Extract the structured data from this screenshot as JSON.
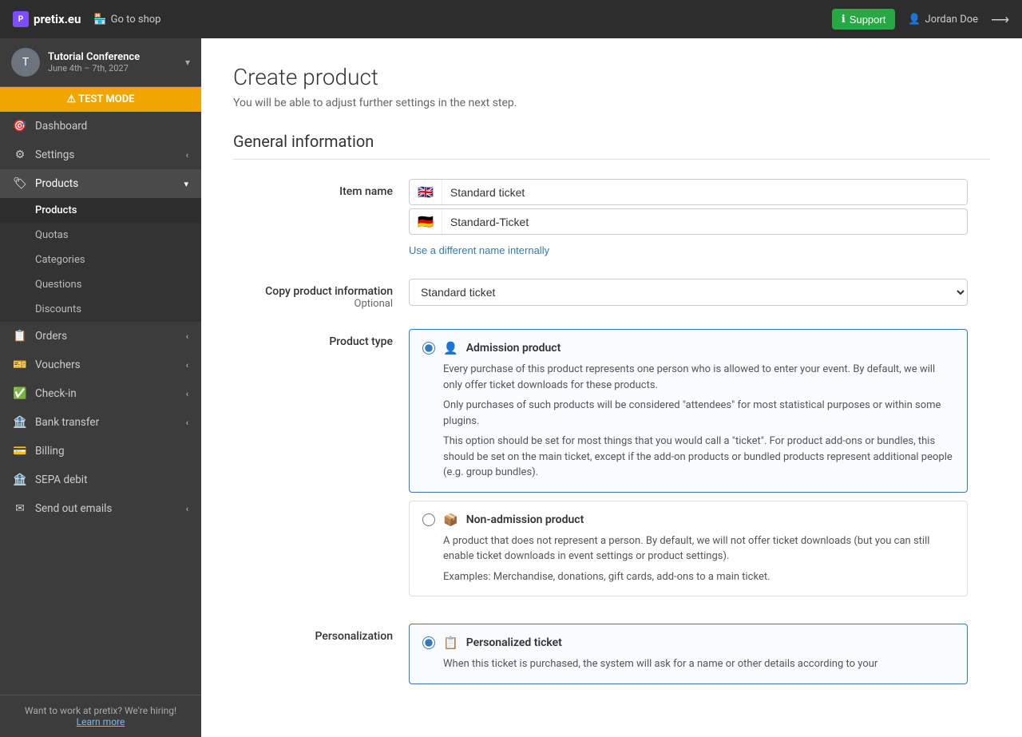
{
  "navbar": {
    "brand": "pretix.eu",
    "goto_shop": "Go to shop",
    "support": "Support",
    "user": "Jordan Doe",
    "logout_icon": "→"
  },
  "sidebar": {
    "event_name": "Tutorial Conference",
    "event_date": "June 4th – 7th, 2027",
    "test_mode": "⚠ TEST MODE",
    "items": [
      {
        "id": "dashboard",
        "label": "Dashboard",
        "icon": "🎯",
        "has_caret": false
      },
      {
        "id": "settings",
        "label": "Settings",
        "icon": "⚙",
        "has_caret": true
      },
      {
        "id": "products",
        "label": "Products",
        "icon": "🏷",
        "has_caret": true,
        "active": true
      }
    ],
    "products_subitems": [
      {
        "id": "products-list",
        "label": "Products",
        "active": true
      },
      {
        "id": "quotas",
        "label": "Quotas"
      },
      {
        "id": "categories",
        "label": "Categories"
      },
      {
        "id": "questions",
        "label": "Questions"
      },
      {
        "id": "discounts",
        "label": "Discounts"
      }
    ],
    "other_items": [
      {
        "id": "orders",
        "label": "Orders",
        "icon": "📋",
        "has_caret": true
      },
      {
        "id": "vouchers",
        "label": "Vouchers",
        "icon": "🎫",
        "has_caret": true
      },
      {
        "id": "checkin",
        "label": "Check-in",
        "icon": "✅",
        "has_caret": true
      },
      {
        "id": "bank-transfer",
        "label": "Bank transfer",
        "icon": "🏦",
        "has_caret": true
      },
      {
        "id": "billing",
        "label": "Billing",
        "icon": "💳",
        "has_caret": false
      },
      {
        "id": "sepa-debit",
        "label": "SEPA debit",
        "icon": "🏦",
        "has_caret": false
      },
      {
        "id": "send-out",
        "label": "Send out emails",
        "icon": "✉",
        "has_caret": true
      }
    ],
    "footer_text": "Want to work at pretix? We're hiring!",
    "footer_link": "Learn more"
  },
  "page": {
    "title": "Create product",
    "subtitle": "You will be able to adjust further settings in the next step.",
    "section_general": "General information"
  },
  "form": {
    "item_name_label": "Item name",
    "name_en_value": "Standard ticket",
    "name_de_value": "Standard-Ticket",
    "flag_en": "🇬🇧",
    "flag_de": "🇩🇪",
    "use_different_name": "Use a different name internally",
    "copy_info_label": "Copy product information",
    "copy_info_optional": "Optional",
    "copy_info_select_value": "Standard ticket",
    "copy_info_options": [
      "Standard ticket"
    ],
    "product_type_label": "Product type",
    "admission_label": "Admission product",
    "admission_desc1": "Every purchase of this product represents one person who is allowed to enter your event. By default, we will only offer ticket downloads for these products.",
    "admission_desc2": "Only purchases of such products will be considered \"attendees\" for most statistical purposes or within some plugins.",
    "admission_desc3": "This option should be set for most things that you would call a \"ticket\". For product add-ons or bundles, this should be set on the main ticket, except if the add-on products or bundled products represent additional people (e.g. group bundles).",
    "non_admission_label": "Non-admission product",
    "non_admission_desc1": "A product that does not represent a person. By default, we will not offer ticket downloads (but you can still enable ticket downloads in event settings or product settings).",
    "non_admission_desc2": "Examples: Merchandise, donations, gift cards, add-ons to a main ticket.",
    "personalization_label": "Personalization",
    "personalized_label": "Personalized ticket",
    "personalized_desc": "When this ticket is purchased, the system will ask for a name or other details according to your"
  }
}
